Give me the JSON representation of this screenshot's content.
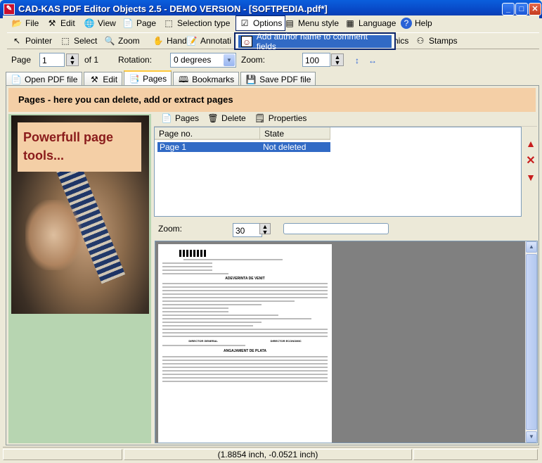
{
  "window": {
    "title": "CAD-KAS PDF Editor Objects 2.5 - DEMO VERSION - [SOFTPEDIA.pdf*]",
    "app_icon": "pdf-icon"
  },
  "menu": {
    "file": "File",
    "edit": "Edit",
    "view": "View",
    "page": "Page",
    "selection_type": "Selection type",
    "options": "Options",
    "menu_style": "Menu style",
    "language": "Language",
    "help": "Help"
  },
  "tools": {
    "pointer": "Pointer",
    "select": "Select",
    "zoom": "Zoom",
    "hand": "Hand",
    "annotation": "Annotati",
    "graphics": "hics",
    "stamps": "Stamps"
  },
  "dropdown": {
    "item": "Add author name to comment fields"
  },
  "nav": {
    "page_label": "Page",
    "page_value": "1",
    "of_label": "of 1",
    "rotation_label": "Rotation:",
    "rotation_value": "0 degrees",
    "zoom_label": "Zoom:",
    "zoom_value": "100"
  },
  "tabs": [
    "Open PDF file",
    "Edit",
    "Pages",
    "Bookmarks",
    "Save PDF file"
  ],
  "pages": {
    "banner": "Pages - here you can delete, add or extract pages",
    "promo": "Powerfull page tools...",
    "toolbar": {
      "pages": "Pages",
      "delete": "Delete",
      "properties": "Properties"
    },
    "columns": [
      "Page no.",
      "State"
    ],
    "rows": [
      {
        "page": "Page 1",
        "state": "Not deleted"
      }
    ],
    "zoom_label": "Zoom:",
    "zoom_value": "30"
  },
  "document": {
    "heading": "ADEVERINTA DE VENIT",
    "title2": "ANGAJAMENT DE PLATA",
    "label_director": "DIRECTOR GENERAL",
    "label_economic": "DIRECTOR ECONOMIC"
  },
  "status": {
    "coords": "(1.8854 inch, -0.0521 inch)"
  }
}
